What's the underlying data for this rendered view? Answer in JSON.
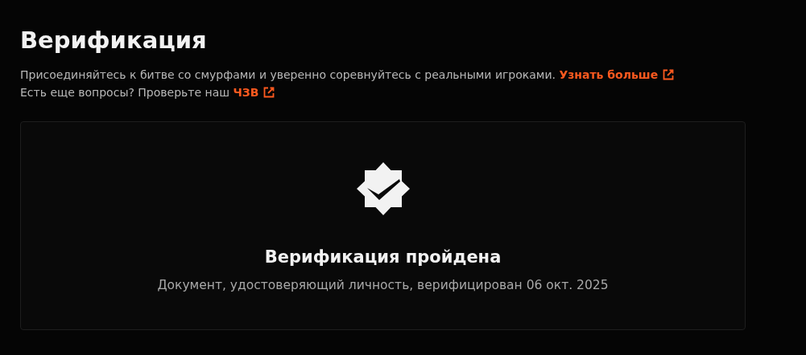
{
  "title": "Верификация",
  "intro": [
    {
      "text": "Присоединяйтесь к битве со смурфами и уверенно соревнуйтесь с реальными игроками.",
      "link": "Узнать больше"
    },
    {
      "text": "Есть еще вопросы? Проверьте наш",
      "link": "ЧЗВ"
    }
  ],
  "status": {
    "verified": true,
    "title": "Верификация пройдена",
    "detail": "Документ, удостоверяющий личность, верифицирован 06 окт. 2025"
  }
}
